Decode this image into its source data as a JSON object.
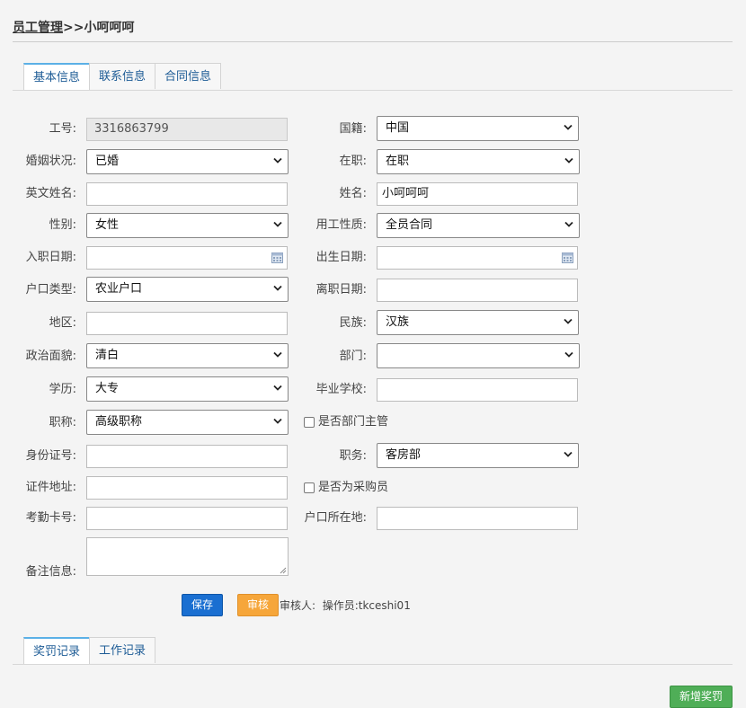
{
  "header": {
    "title_main": "员工管理",
    "title_sep": ">>",
    "title_name": "小呵呵呵"
  },
  "top_tabs": [
    "基本信息",
    "联系信息",
    "合同信息"
  ],
  "form": {
    "emp_no": {
      "label": "工号:",
      "value": "3316863799"
    },
    "nationality": {
      "label": "国籍:",
      "value": "中国"
    },
    "marital": {
      "label": "婚姻状况:",
      "value": "已婚"
    },
    "employed": {
      "label": "在职:",
      "value": "在职"
    },
    "english_name": {
      "label": "英文姓名:",
      "value": ""
    },
    "name": {
      "label": "姓名:",
      "value": "小呵呵呵"
    },
    "gender": {
      "label": "性别:",
      "value": "女性"
    },
    "employment_type": {
      "label": "用工性质:",
      "value": "全员合同"
    },
    "hire_date": {
      "label": "入职日期:",
      "value": ""
    },
    "birth_date": {
      "label": "出生日期:",
      "value": ""
    },
    "hukou_type": {
      "label": "户口类型:",
      "value": "农业户口"
    },
    "leave_date": {
      "label": "离职日期:",
      "value": ""
    },
    "region": {
      "label": "地区:",
      "value": ""
    },
    "ethnicity": {
      "label": "民族:",
      "value": "汉族"
    },
    "political": {
      "label": "政治面貌:",
      "value": "清白"
    },
    "department": {
      "label": "部门:",
      "value": ""
    },
    "education": {
      "label": "学历:",
      "value": "大专"
    },
    "school": {
      "label": "毕业学校:",
      "value": ""
    },
    "title": {
      "label": "职称:",
      "value": "高级职称"
    },
    "is_dept_head": {
      "label": "是否部门主管"
    },
    "id_number": {
      "label": "身份证号:",
      "value": ""
    },
    "position": {
      "label": "职务:",
      "value": "客房部"
    },
    "id_address": {
      "label": "证件地址:",
      "value": ""
    },
    "is_buyer": {
      "label": "是否为采购员"
    },
    "attendance_card": {
      "label": "考勤卡号:",
      "value": ""
    },
    "hukou_location": {
      "label": "户口所在地:",
      "value": ""
    },
    "remarks": {
      "label": "备注信息:",
      "value": ""
    }
  },
  "actions": {
    "save": "保存",
    "audit": "审核",
    "auditor_label": "审核人:",
    "operator_label": "操作员:",
    "operator_value": "tkceshi01"
  },
  "bottom_tabs": [
    "奖罚记录",
    "工作记录"
  ],
  "add_button": "新增奖罚",
  "colors": {
    "save": "#1a6fd1",
    "audit": "#f6a63a",
    "add": "#4fae57",
    "tab_accent": "#5bb0e6"
  }
}
